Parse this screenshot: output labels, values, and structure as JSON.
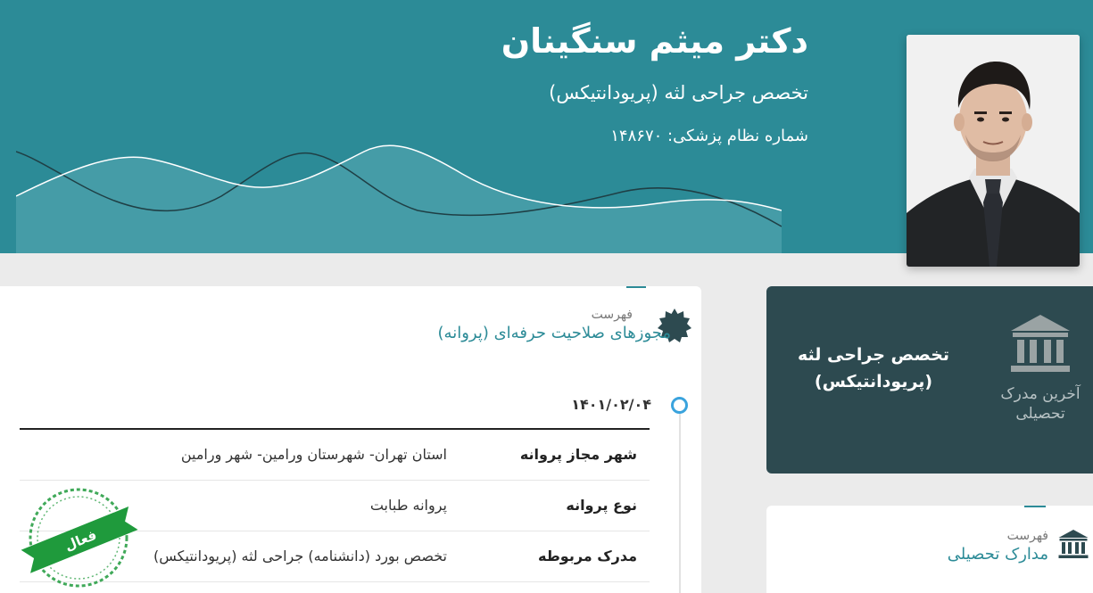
{
  "profile": {
    "name": "دکتر میثم سنگینان",
    "specialty": "تخصص جراحی لثه (پریودانتیکس)",
    "license_label": "شماره نظام پزشکی:",
    "license_number": "۱۴۸۶۷۰"
  },
  "degree_card": {
    "title": "تخصص جراحی لثه (پریودانتیکس)",
    "caption": "آخرین مدرک تحصیلی",
    "icon": "institution-icon"
  },
  "licenses": {
    "small_label": "فهرست",
    "title": "مجوزهای صلاحیت حرفه‌ای (پروانه)",
    "icon": "badge-icon",
    "date": "۱۴۰۱/۰۲/۰۴",
    "rows": [
      {
        "label": "شهر مجاز پروانه",
        "value": "استان تهران- شهرستان ورامین- شهر ورامین"
      },
      {
        "label": "نوع پروانه",
        "value": "پروانه طبابت"
      },
      {
        "label": "مدرک مربوطه",
        "value": "تخصص بورد (دانشنامه) جراحی لثه (پریودانتیکس)"
      }
    ],
    "status": "فعال"
  },
  "education": {
    "small_label": "فهرست",
    "title": "مدارک تحصیلی",
    "icon": "institution-icon"
  },
  "colors": {
    "header_bg": "#2c8b97",
    "dark_card": "#2d4a50",
    "accent": "#2c8b97",
    "stamp_green": "#1f9a3c",
    "timeline_dot": "#3aa3dd"
  }
}
